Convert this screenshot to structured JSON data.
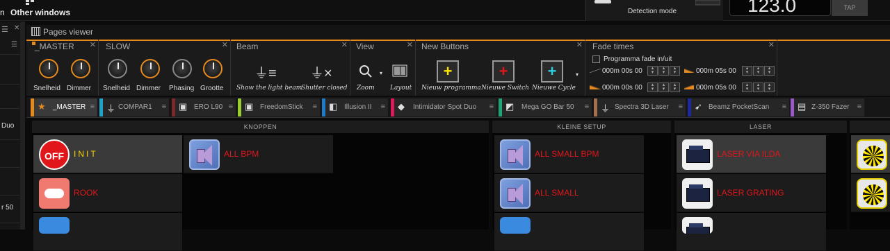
{
  "topbar": {
    "left_fragment": "n",
    "other_windows_label": "Other windows",
    "detection_mode_label": "Detection mode",
    "bpm_value": "123.0",
    "tap_label": "TAP"
  },
  "left_panel": {
    "items": [
      "Duo",
      "r 50"
    ]
  },
  "pages_viewer": {
    "title": "Pages viewer"
  },
  "toolbar": {
    "master": {
      "title": "_MASTER",
      "knobs": [
        {
          "label": "Snelheid",
          "accent": "#e58a1f"
        },
        {
          "label": "Dimmer",
          "accent": "#e58a1f"
        }
      ]
    },
    "slow": {
      "title": "SLOW",
      "knobs": [
        {
          "label": "Snelheid"
        },
        {
          "label": "Dimmer"
        },
        {
          "label": "Phasing"
        },
        {
          "label": "Grootte"
        }
      ]
    },
    "beam": {
      "title": "Beam",
      "buttons": [
        {
          "label": "Show the light beam",
          "icon": "light-beam-icon"
        },
        {
          "label": "Shutter closed",
          "icon": "shutter-closed-icon"
        }
      ]
    },
    "view": {
      "title": "View",
      "buttons": [
        {
          "label": "Zoom",
          "icon": "zoom-icon"
        },
        {
          "label": "Layout",
          "icon": "layout-icon"
        }
      ]
    },
    "new_buttons": {
      "title": "New Buttons",
      "buttons": [
        {
          "label": "Nieuw programma",
          "icon": "plus-icon",
          "color": "#ffe600"
        },
        {
          "label": "Nieuwe Switch",
          "icon": "plus-icon",
          "color": "#e0161b"
        },
        {
          "label": "Nieuwe Cycle",
          "icon": "plus-icon",
          "color": "#28d0e0"
        }
      ]
    },
    "fade_times": {
      "title": "Fade times",
      "checkbox_label": "Programma fade in/uit",
      "checked": false,
      "times": [
        "000m 00s 00",
        "000m 05s 00",
        "000m 00s 00",
        "000m 05s 00"
      ]
    }
  },
  "tabs": [
    {
      "label": "_MASTER",
      "color": "#e58a1f",
      "icon": "star-icon",
      "active": true
    },
    {
      "label": "COMPAR1",
      "color": "#1fa3c8",
      "icon": "spot-light-icon"
    },
    {
      "label": "ERO L90",
      "color": "#7a2a2a",
      "icon": "projector-icon"
    },
    {
      "label": "FreedomStick",
      "color": "#9acd32",
      "icon": "projector-icon"
    },
    {
      "label": "Illusion II",
      "color": "#1f7ac8",
      "icon": "laser-fixture-icon"
    },
    {
      "label": "Intimidator Spot Duo",
      "color": "#d81b5a",
      "icon": "moving-head-icon"
    },
    {
      "label": "Mega GO Bar 50",
      "color": "#1fa37a",
      "icon": "bar-icon"
    },
    {
      "label": "Spectra 3D Laser",
      "color": "#a07050",
      "icon": "spot-light-icon"
    },
    {
      "label": "Beamz PocketScan",
      "color": "#1f2a9a",
      "icon": "scanner-icon"
    },
    {
      "label": "Z-350 Fazer",
      "color": "#9a5ac8",
      "icon": "fazer-icon"
    }
  ],
  "sections": {
    "knoppen": {
      "title": "KNOPPEN",
      "buttons": [
        {
          "label": "INIT",
          "icon": "off-icon"
        },
        {
          "label": "ALL BPM",
          "icon": "speaker-icon"
        },
        {
          "label": "ROOK",
          "icon": "cloud-icon"
        }
      ]
    },
    "kleine_setup": {
      "title": "KLEINE SETUP",
      "buttons": [
        {
          "label": "ALL SMALL BPM",
          "icon": "speaker-icon"
        },
        {
          "label": "ALL SMALL",
          "icon": "speaker-icon"
        }
      ]
    },
    "laser": {
      "title": "LASER",
      "buttons": [
        {
          "label": "LASER VIA ILDA",
          "icon": "laser-icon"
        },
        {
          "label": "LASER GRATING",
          "icon": "laser-icon"
        }
      ]
    }
  }
}
